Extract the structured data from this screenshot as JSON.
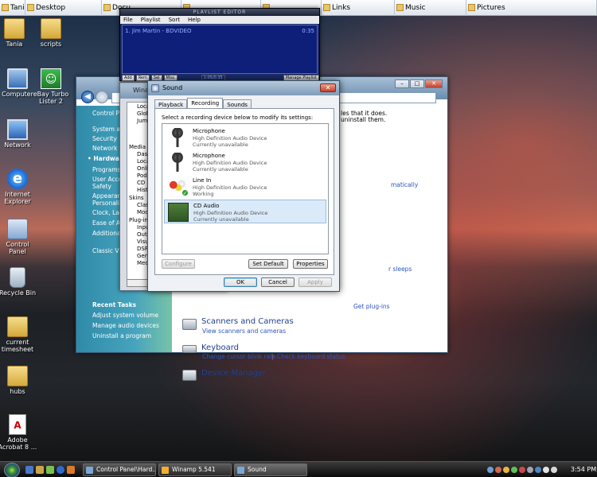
{
  "links_bar": {
    "items": [
      {
        "label": "Tania",
        "w": 32
      },
      {
        "label": "Desktop",
        "w": 96
      },
      {
        "label": "Docu",
        "w": 100
      },
      {
        "label": "",
        "w": 100
      },
      {
        "label": "",
        "w": 76
      },
      {
        "label": "Links",
        "w": 92
      },
      {
        "label": "Music",
        "w": 90
      },
      {
        "label": "Pictures",
        "w": 164
      }
    ]
  },
  "desktop_icons": {
    "tania": "Tania",
    "scripts": "scripts",
    "computer": "Computer",
    "ebay_line1": "eBay Turbo",
    "ebay_line2": "Lister 2",
    "network": "Network",
    "ie_line1": "Internet",
    "ie_line2": "Explorer",
    "control_panel_line1": "Control",
    "control_panel_line2": "Panel",
    "recycle_bin": "Recycle Bin",
    "timesheet_line1": "current",
    "timesheet_line2": "timesheet",
    "hubs": "hubs",
    "acrobat_line1": "Adobe",
    "acrobat_line2": "Acrobat 8 ..."
  },
  "playlist_editor": {
    "title": "PLAYLIST EDITOR",
    "menu": [
      "File",
      "Playlist",
      "Sort",
      "Help"
    ],
    "entry": "1. Jim Martin - BDVIDEO",
    "duration": "0:35",
    "buttons": [
      "Add",
      "Rem",
      "Sel",
      "Misc"
    ],
    "time_display": "1:05/0:35",
    "manage": "Manage Playlist"
  },
  "winamp_main": {
    "title": "Winam",
    "tree": [
      "Local",
      "Glob",
      "Jump",
      "Media Li",
      "Dash",
      "Loca",
      "Onli",
      "Pod",
      "CD R",
      "Histo",
      "Skins",
      "Class",
      "Mod",
      "Plug-ins",
      "Inpu",
      "Outp",
      "Visu",
      "DSP",
      "Gen",
      "Med"
    ]
  },
  "control_panel": {
    "sidebar": {
      "home": "Control Pa",
      "items": [
        "System and",
        "Security",
        "Network and",
        "Hardware",
        "Programs",
        "User Accou",
        "Safety",
        "Appearanc",
        "Personaliz",
        "Clock, Lan",
        "Ease of Acc",
        "Additional"
      ],
      "classic_view": "Classic Vie",
      "recent_tasks": "Recent Tasks",
      "tasks": [
        "Adjust system volume",
        "Manage audio devices",
        "Uninstall a program"
      ]
    },
    "right_snips": [
      "les that it does.",
      "uninstall them.",
      "matically",
      "r sleeps",
      "Get plug-ins"
    ],
    "categories": [
      {
        "title": "Scanners and Cameras",
        "links": [
          "View scanners and cameras"
        ]
      },
      {
        "title": "Keyboard",
        "links": [
          "Change cursor blink rate",
          "Check keyboard status"
        ]
      },
      {
        "title": "Device Manager",
        "links": []
      }
    ]
  },
  "sound_dialog": {
    "title": "Sound",
    "tabs": [
      "Playback",
      "Recording",
      "Sounds"
    ],
    "active_tab": "Recording",
    "instruction": "Select a recording device below to modify its settings:",
    "devices": [
      {
        "name": "Microphone",
        "desc": "High Definition Audio Device",
        "status": "Currently unavailable",
        "icon": "microphone-icon",
        "selected": false
      },
      {
        "name": "Microphone",
        "desc": "High Definition Audio Device",
        "status": "Currently unavailable",
        "icon": "microphone-icon",
        "selected": false
      },
      {
        "name": "Line In",
        "desc": "High Definition Audio Device",
        "status": "Working",
        "icon": "line-in-icon",
        "selected": false
      },
      {
        "name": "CD Audio",
        "desc": "High Definition Audio Device",
        "status": "Currently unavailable",
        "icon": "cd-audio-icon",
        "selected": true
      }
    ],
    "buttons": {
      "configure": "Configure",
      "set_default": "Set Default",
      "properties": "Properties",
      "ok": "OK",
      "cancel": "Cancel",
      "apply": "Apply"
    }
  },
  "taskbar": {
    "tasks": [
      "Control Panel\\Hard...",
      "Winamp 5.541",
      "Sound"
    ],
    "clock": "3:54 PM"
  }
}
